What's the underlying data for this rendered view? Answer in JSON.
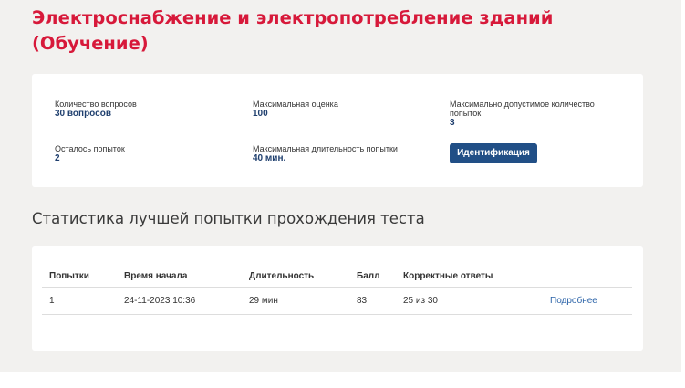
{
  "page": {
    "title": "Электроснабжение и электропотребление зданий (Обучение)"
  },
  "info": {
    "questions_label": "Количество вопросов",
    "questions_value": "30 вопросов",
    "max_score_label": "Максимальная оценка",
    "max_score_value": "100",
    "max_attempts_label": "Максимально допустимое количество попыток",
    "max_attempts_value": "3",
    "remaining_label": "Осталось попыток",
    "remaining_value": "2",
    "max_duration_label": "Максимальная длительность попытки",
    "max_duration_value": "40 мин.",
    "identify_button": "Идентификация"
  },
  "stats": {
    "title": "Статистика лучшей попытки прохождения теста",
    "columns": [
      "Попытки",
      "Время начала",
      "Длительность",
      "Балл",
      "Корректные ответы",
      ""
    ],
    "rows": [
      {
        "attempt": "1",
        "start_time": "24-11-2023 10:36",
        "duration": "29 мин",
        "score": "83",
        "correct": "25 из 30",
        "details_link": "Подробнее"
      }
    ]
  },
  "colors": {
    "title": "#d7193a",
    "value": "#1f3f6e",
    "button": "#214f86",
    "link": "#2b63a8",
    "background": "#f2f1ef"
  }
}
